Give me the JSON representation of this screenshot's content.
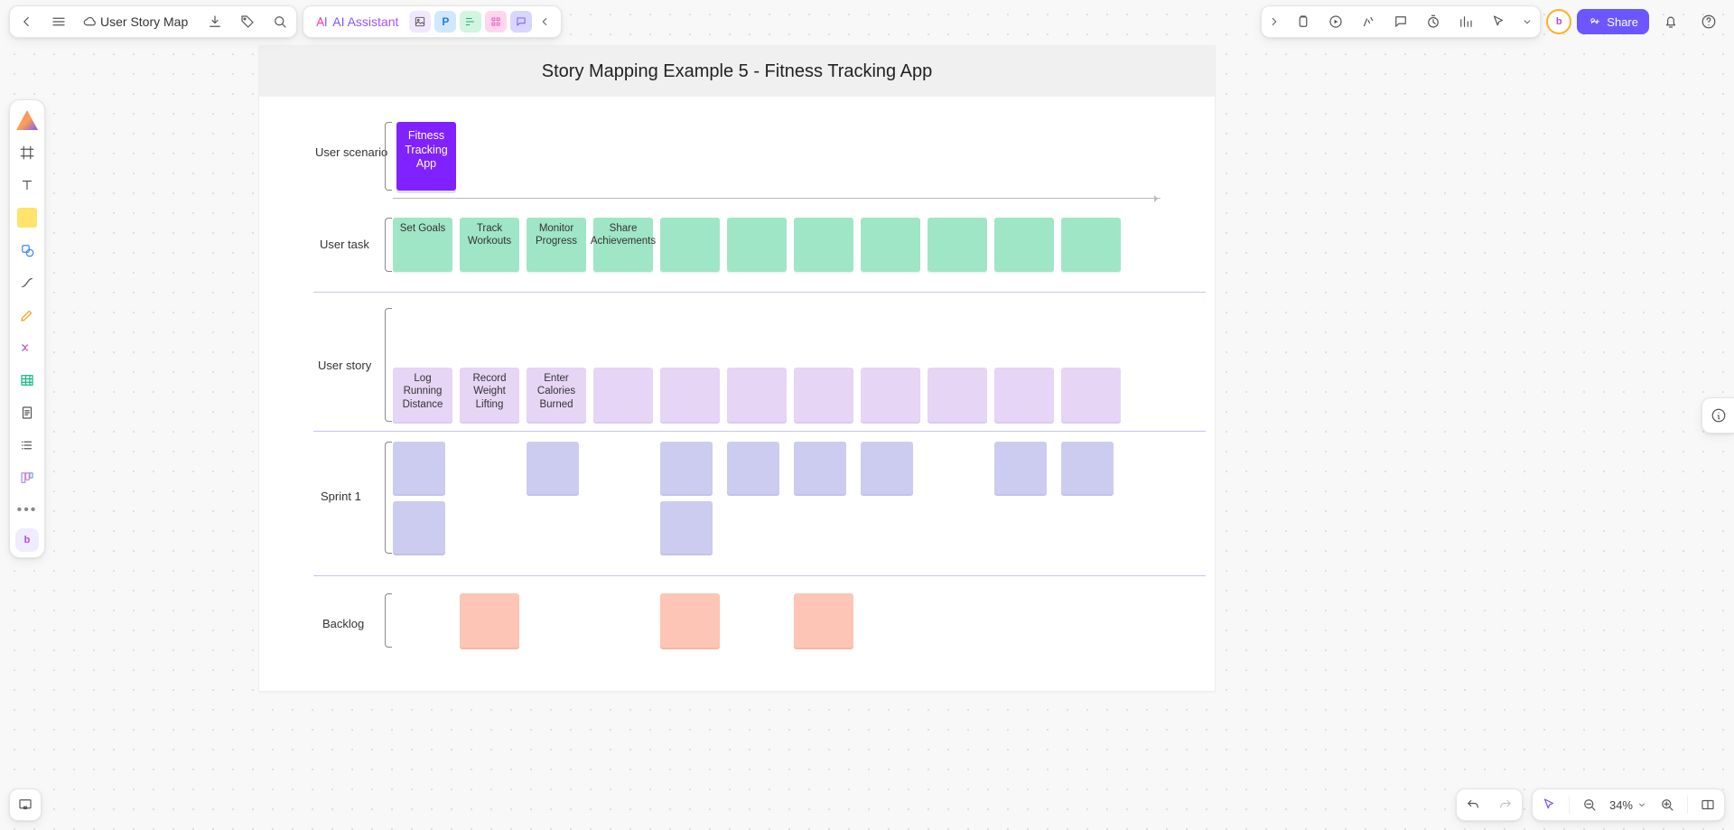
{
  "doc": {
    "title": "User Story Map"
  },
  "ai": {
    "label": "AI Assistant"
  },
  "share": {
    "label": "Share"
  },
  "zoom": {
    "value": "34%"
  },
  "artboard": {
    "title": "Story Mapping Example 5 - Fitness Tracking App"
  },
  "rows": {
    "scenario": {
      "label": "User scenario",
      "cards": [
        "Fitness Tracking App"
      ]
    },
    "task": {
      "label": "User task",
      "cards": [
        "Set Goals",
        "Track Workouts",
        "Monitor Progress",
        "Share Achievements",
        "",
        "",
        "",
        "",
        "",
        "",
        ""
      ]
    },
    "story": {
      "label": "User story",
      "cards": [
        "Log Running Distance",
        "Record Weight Lifting",
        "Enter Calories Burned",
        "",
        "",
        "",
        "",
        "",
        "",
        "",
        ""
      ]
    },
    "sprint1": {
      "label": "Sprint 1"
    },
    "backlog": {
      "label": "Backlog"
    }
  },
  "sprint1_slots": [
    true,
    false,
    true,
    false,
    true,
    true,
    true,
    true,
    false,
    true,
    true
  ],
  "sprint1_row2_slots": [
    true,
    false,
    false,
    false,
    true,
    false,
    false,
    false,
    false,
    false,
    false
  ],
  "backlog_slots": [
    false,
    true,
    false,
    false,
    true,
    false,
    true,
    false,
    false,
    false,
    false
  ],
  "chart_data": {
    "type": "table",
    "title": "Story Mapping Example 5 - Fitness Tracking App",
    "rows": [
      {
        "name": "User scenario",
        "items": [
          "Fitness Tracking App"
        ]
      },
      {
        "name": "User task",
        "items": [
          "Set Goals",
          "Track Workouts",
          "Monitor Progress",
          "Share Achievements",
          "(empty)",
          "(empty)",
          "(empty)",
          "(empty)",
          "(empty)",
          "(empty)",
          "(empty)"
        ]
      },
      {
        "name": "User story",
        "items": [
          "Log Running Distance",
          "Record Weight Lifting",
          "Enter Calories Burned",
          "(empty)",
          "(empty)",
          "(empty)",
          "(empty)",
          "(empty)",
          "(empty)",
          "(empty)",
          "(empty)"
        ]
      },
      {
        "name": "Sprint 1 row1",
        "items": [
          "card",
          "",
          "card",
          "",
          "card",
          "card",
          "card",
          "card",
          "",
          "card",
          "card"
        ]
      },
      {
        "name": "Sprint 1 row2",
        "items": [
          "card",
          "",
          "",
          "",
          "card",
          "",
          "",
          "",
          "",
          "",
          ""
        ]
      },
      {
        "name": "Backlog",
        "items": [
          "",
          "card",
          "",
          "",
          "card",
          "",
          "card",
          "",
          "",
          "",
          ""
        ]
      }
    ]
  }
}
